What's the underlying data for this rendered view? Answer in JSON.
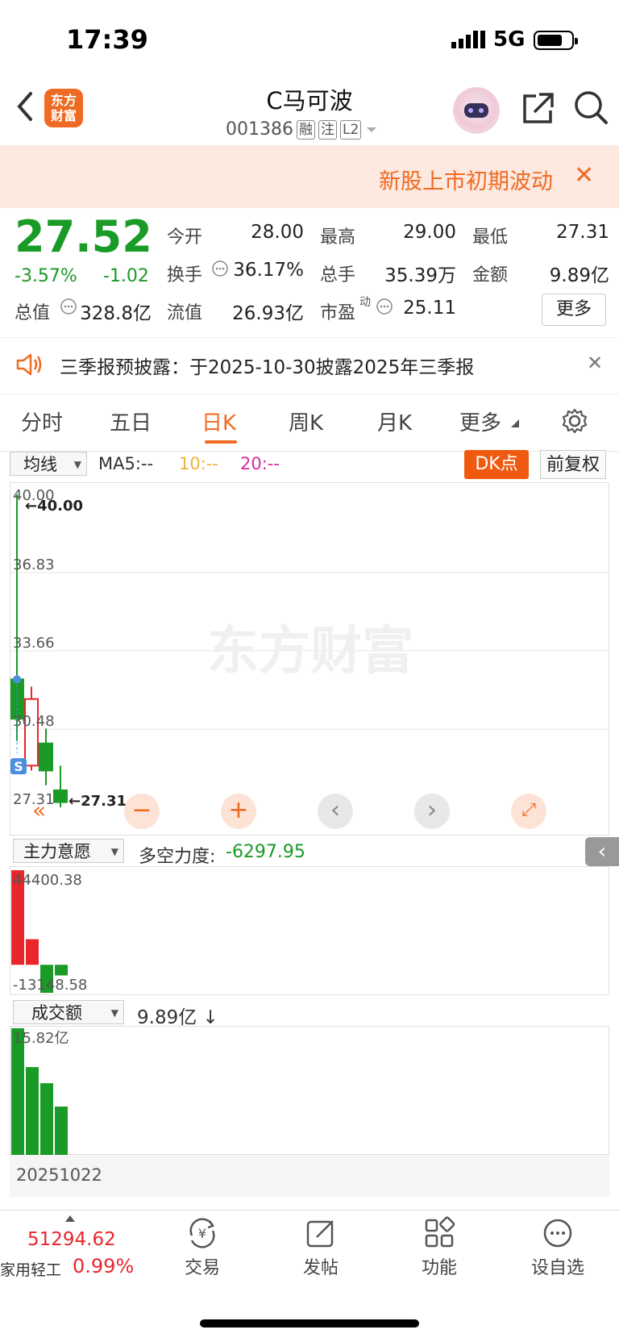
{
  "status": {
    "time": "17:39",
    "network": "5G"
  },
  "header": {
    "logo_line1": "东方",
    "logo_line2": "财富",
    "name": "C马可波",
    "code": "001386",
    "tags": [
      "融",
      "注",
      "L2"
    ]
  },
  "notice": {
    "text": "新股上市初期波动"
  },
  "quote": {
    "price": "27.52",
    "pct": "-3.57%",
    "change": "-1.02",
    "open_label": "今开",
    "open": "28.00",
    "high_label": "最高",
    "high": "29.00",
    "low_label": "最低",
    "low": "27.31",
    "turnover_label": "换手",
    "turnover": "36.17%",
    "volume_label": "总手",
    "volume": "35.39万",
    "amount_label": "金额",
    "amount": "9.89亿",
    "mktcap_label": "总值",
    "mktcap": "328.8亿",
    "float_label": "流值",
    "float": "26.93亿",
    "pe_label": "市盈",
    "pe_sup": "动",
    "pe": "25.11",
    "more": "更多"
  },
  "announcement": {
    "text": "三季报预披露：于2025-10-30披露2025年三季报"
  },
  "tabs": [
    {
      "label": "分时"
    },
    {
      "label": "五日"
    },
    {
      "label": "日K"
    },
    {
      "label": "周K"
    },
    {
      "label": "月K"
    },
    {
      "label": "更多"
    }
  ],
  "toolbar": {
    "ma_select": "均线",
    "ma5": "MA5:--",
    "ma10": "10:--",
    "ma20": "20:--",
    "dk": "DK点",
    "fq": "前复权"
  },
  "chart_data": [
    {
      "type": "candlestick",
      "title": "",
      "y_tick_labels": [
        "40.00",
        "36.83",
        "33.66",
        "30.48",
        "27.31"
      ],
      "ylim": [
        27.31,
        40.0
      ],
      "annotations": [
        "←40.00",
        "←27.31"
      ],
      "candles": [
        {
          "open": 32.5,
          "close": 30.9,
          "high": 40.0,
          "low": 30.0
        },
        {
          "open": 29.0,
          "close": 31.7,
          "high": 32.2,
          "low": 28.8
        },
        {
          "open": 29.9,
          "close": 28.8,
          "high": 30.5,
          "low": 28.2
        },
        {
          "open": 28.0,
          "close": 27.52,
          "high": 29.0,
          "low": 27.31
        }
      ],
      "marker": "S"
    },
    {
      "type": "bar",
      "title": "主力意愿",
      "y_tick_labels": [
        "44400.38",
        "-13148.58"
      ],
      "ylim": [
        -13148.58,
        44400.38
      ],
      "values": [
        44400.38,
        12000,
        -13148.58,
        -5000
      ]
    },
    {
      "type": "bar",
      "title": "成交额",
      "y_tick_labels": [
        "15.82亿"
      ],
      "ylim": [
        0,
        15.82
      ],
      "values": [
        15.82,
        11.0,
        9.0,
        6.1
      ],
      "x_label": "20251022"
    }
  ],
  "indicator": {
    "select": "主力意愿",
    "label": "多空力度:",
    "value": "-6297.95"
  },
  "volume": {
    "select": "成交额",
    "value": "9.89亿 ↓"
  },
  "watermark": "东方财富",
  "bottom": {
    "index_value": "51294.62",
    "index_name": "家用轻工",
    "index_pct": "0.99%",
    "nav": [
      {
        "label": "交易"
      },
      {
        "label": "发帖"
      },
      {
        "label": "功能"
      },
      {
        "label": "设自选"
      }
    ]
  }
}
